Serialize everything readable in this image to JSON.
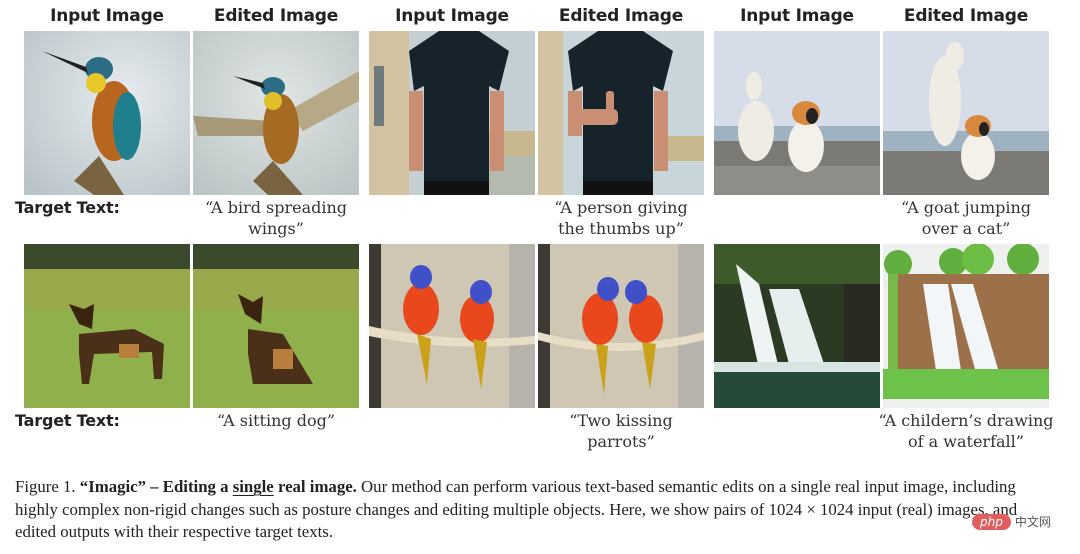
{
  "figure": {
    "column_headers": [
      "Input Image",
      "Edited Image",
      "Input Image",
      "Edited Image",
      "Input Image",
      "Edited Image"
    ],
    "row_label": "Target Text:",
    "rows": [
      {
        "pairs": [
          {
            "input": "kingfisher perched on branch",
            "edited": "kingfisher with spread wings",
            "target_text": "“A bird spreading\nwings”"
          },
          {
            "input": "person in black t-shirt",
            "edited": "person giving thumbs up",
            "target_text": "“A person giving\nthe thumbs up”"
          },
          {
            "input": "goat and cat by the sea",
            "edited": "goat jumping over cat",
            "target_text": "“A goat jumping\nover a cat”"
          }
        ]
      },
      {
        "pairs": [
          {
            "input": "standing german shepherd",
            "edited": "sitting german shepherd",
            "target_text": "“A sitting dog”"
          },
          {
            "input": "two parrots on a rope",
            "edited": "two parrots kissing",
            "target_text": "“Two kissing\nparrots”"
          },
          {
            "input": "photo of a waterfall",
            "edited": "children's drawing of a waterfall",
            "target_text": "“A childern’s drawing\nof a waterfall”"
          }
        ]
      }
    ]
  },
  "caption": {
    "prefix": "Figure 1. ",
    "bold_1": "“Imagic” – Editing a ",
    "bold_underlined": "single",
    "bold_2": " real image.",
    "body": " Our method can perform various text-based semantic edits on a single real input image, including highly complex non-rigid changes such as posture changes and editing multiple objects. Here, we show pairs of 1024 × 1024 input (real) images, and edited outputs with their respective target texts."
  },
  "watermark": {
    "brand": "php",
    "suffix": "中文网"
  }
}
